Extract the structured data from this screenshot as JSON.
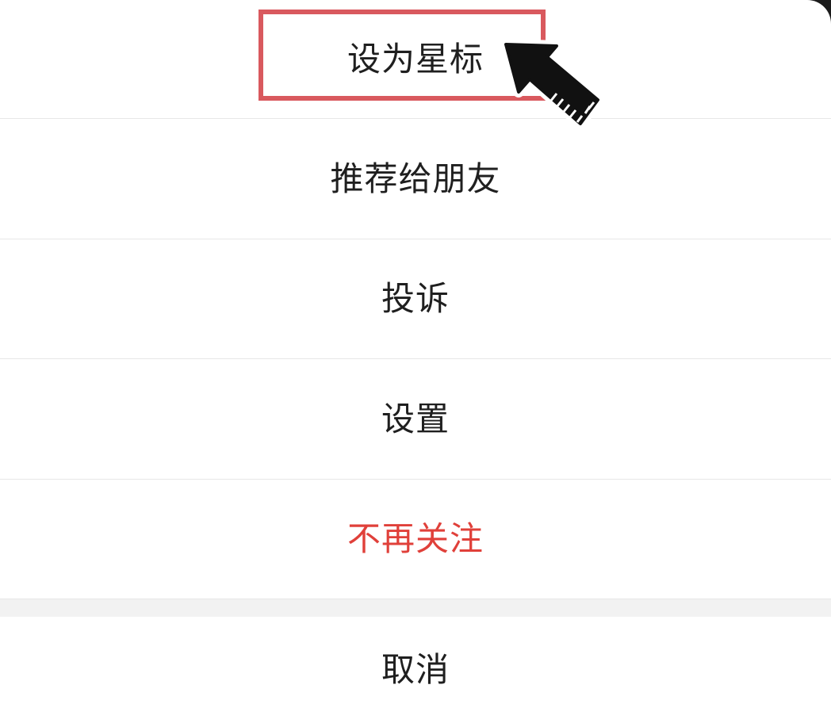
{
  "action_sheet": {
    "items": [
      {
        "label": "设为星标",
        "style": "normal"
      },
      {
        "label": "推荐给朋友",
        "style": "normal"
      },
      {
        "label": "投诉",
        "style": "normal"
      },
      {
        "label": "设置",
        "style": "normal"
      },
      {
        "label": "不再关注",
        "style": "danger"
      }
    ],
    "cancel_label": "取消"
  },
  "annotation": {
    "highlight_color": "#d9595e",
    "pointer_icon": "arrow-pointer-icon"
  },
  "colors": {
    "danger": "#e0403a",
    "divider": "#e7e7e7",
    "gap": "#f2f2f2"
  }
}
